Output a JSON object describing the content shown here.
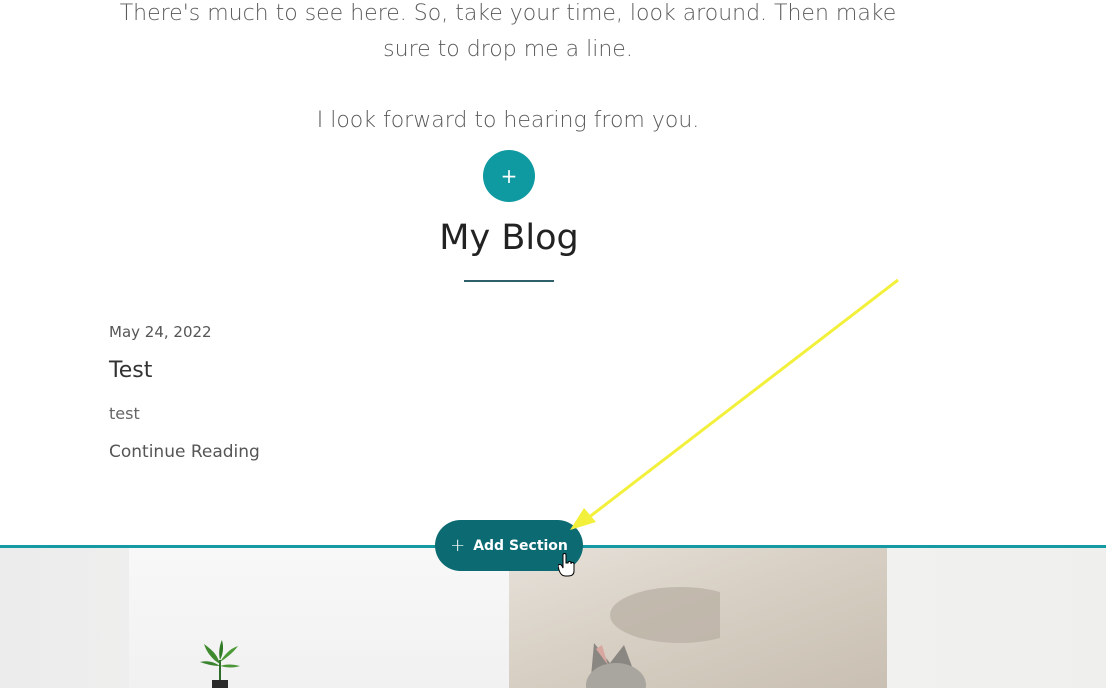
{
  "intro": {
    "line1": "There's much to see here. So, take your time, look around. Then make",
    "line2": "sure to drop me a line.",
    "line3": "I look forward to hearing from you."
  },
  "add_circle": {
    "label": "+"
  },
  "blog": {
    "title": "My Blog",
    "post": {
      "date": "May 24, 2022",
      "title": "Test",
      "excerpt": "test",
      "link": "Continue Reading"
    }
  },
  "add_section": {
    "plus": "+",
    "label": "Add Section"
  },
  "colors": {
    "accent": "#0e9aa0",
    "button": "#0c6b72",
    "arrow": "#f2f03a"
  }
}
